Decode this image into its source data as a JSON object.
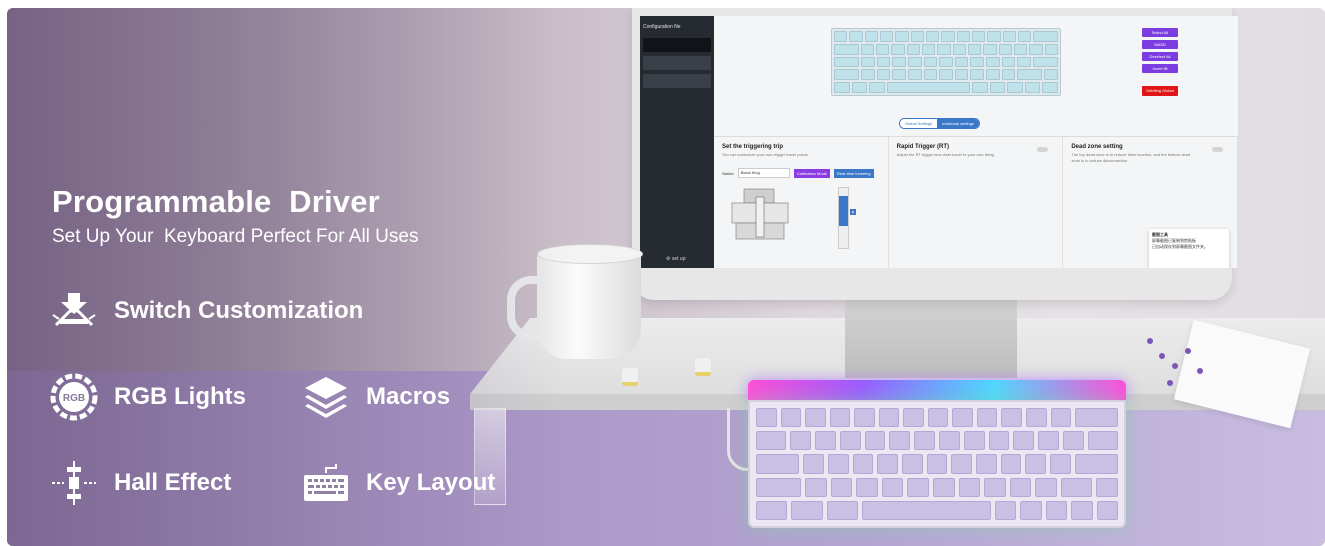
{
  "hero": {
    "title": "Programmable  Driver",
    "subtitle": "Set Up Your  Keyboard Perfect For All Uses"
  },
  "features": [
    {
      "label": "Switch Customization",
      "icon": "switch-press-icon"
    },
    {
      "label": "RGB Lights",
      "icon": "rgb-icon",
      "icon_text": "RGB"
    },
    {
      "label": "Macros",
      "icon": "layers-icon"
    },
    {
      "label": "Hall Effect",
      "icon": "hall-sensor-icon"
    },
    {
      "label": "Key Layout",
      "icon": "keyboard-icon"
    }
  ],
  "screen": {
    "sidebar_title": "Configuration file",
    "setup_label": "set up",
    "side_buttons": [
      "Select All",
      "WASD",
      "Deselect All",
      "Invert fill"
    ],
    "delete_button": "Deleting Global",
    "tabs": [
      "Global Settings",
      "Individual settings"
    ],
    "panels": [
      {
        "title": "Set the triggering trip",
        "desc": "You can customize your own trigger travel points"
      },
      {
        "title": "Rapid Trigger (RT)",
        "desc": "Adjust the RT trigger and reset travel to your own liking"
      },
      {
        "title": "Dead zone setting",
        "desc": "The top dead zone is to reduce false touches, and the bottom dead zone is to reduce disconnection"
      }
    ],
    "switch_label": "Switch",
    "switch_value": "Black King",
    "calibration_button": "Calibration Mode",
    "real_time_button": "Real-time trimming",
    "popup_title": "截图工具",
    "popup_line1": "屏幕截图已复制到剪贴板",
    "popup_line2": "已自动保存到屏幕截图文件夹。"
  },
  "colors": {
    "accent_purple": "#7b3ce0",
    "accent_blue": "#3a77c8",
    "danger_red": "#e01616"
  }
}
